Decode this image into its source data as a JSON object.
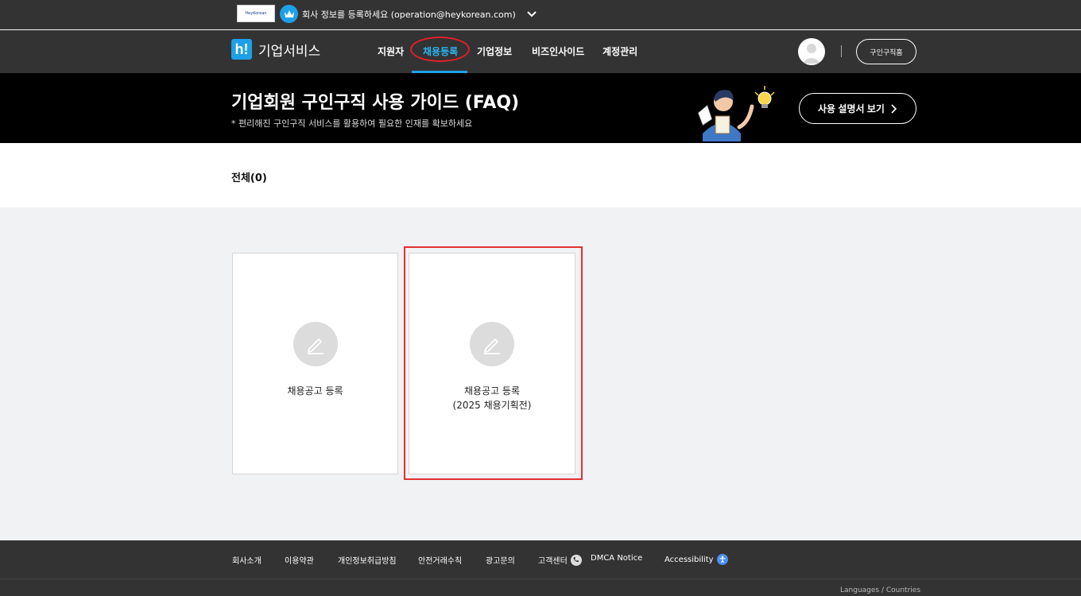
{
  "topbar": {
    "logo_text": "HeyKorean",
    "company_message": "회사 정보를 등록하세요 (operation@heykorean.com)"
  },
  "nav": {
    "brand_icon": "h!",
    "brand": "기업서비스",
    "items": [
      {
        "label": "지원자"
      },
      {
        "label": "채용등록"
      },
      {
        "label": "기업정보"
      },
      {
        "label": "비즈인사이드"
      },
      {
        "label": "계정관리"
      }
    ],
    "active_index": 1,
    "home_button": "구인구직홈"
  },
  "banner": {
    "title": "기업회원 구인구직 사용 가이드 (FAQ)",
    "subtitle": "* 편리해진 구인구직 서비스를 활용하여 필요한 인재를 확보하세요",
    "button": "사용 설명서 보기"
  },
  "filter": {
    "label": "전체(0)"
  },
  "cards": [
    {
      "label": "채용공고 등록",
      "icon": "pencil-icon"
    },
    {
      "label_line1": "채용공고 등록",
      "label_line2": "(2025 채용기획전)",
      "icon": "pencil-icon"
    }
  ],
  "footer": {
    "items": [
      {
        "label": "회사소개"
      },
      {
        "label": "이용약관"
      },
      {
        "label": "개인정보취급방침"
      },
      {
        "label": "안전거래수칙"
      },
      {
        "label": "광고문의"
      },
      {
        "label": "고객센터"
      },
      {
        "label": "DMCA Notice"
      },
      {
        "label": "Accessibility"
      }
    ],
    "languages": "Languages / Countries"
  },
  "colors": {
    "accent": "#1ea0e8",
    "nav_bg": "#333333",
    "highlight": "#e33232"
  }
}
